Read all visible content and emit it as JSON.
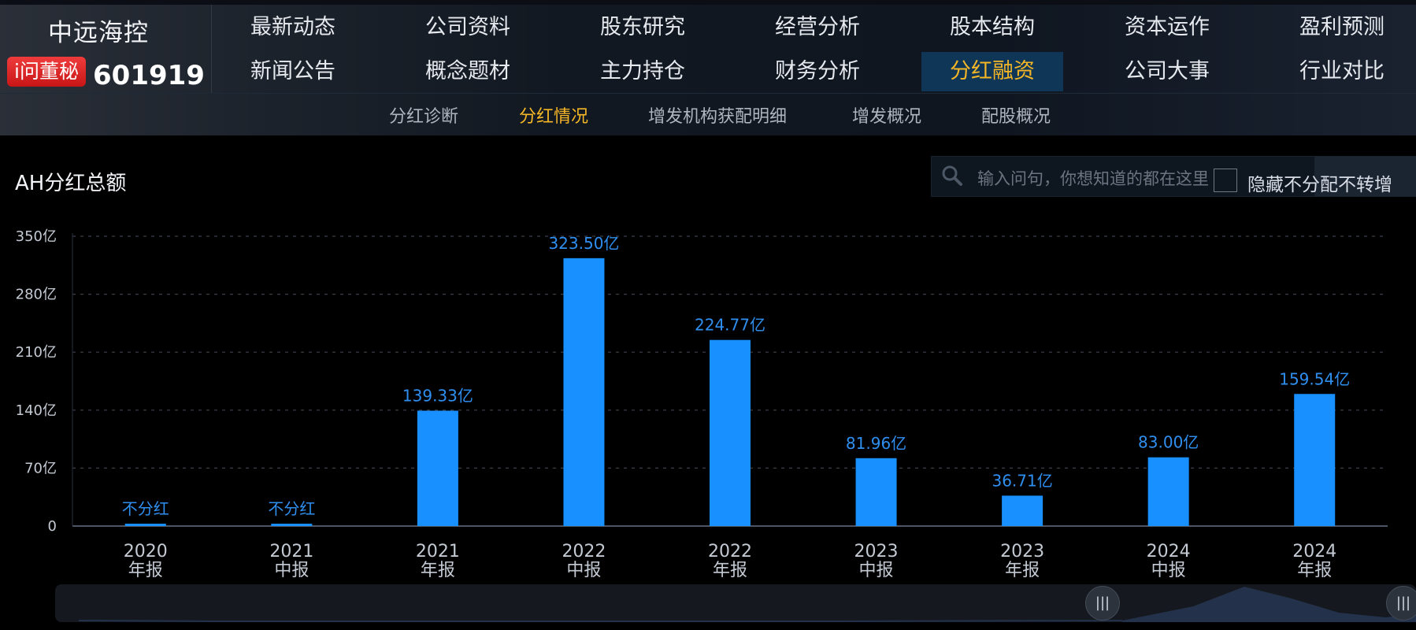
{
  "company": {
    "name": "中远海控",
    "badge": "i问董秘",
    "code": "601919"
  },
  "nav": {
    "row1": [
      "最新动态",
      "公司资料",
      "股东研究",
      "经营分析",
      "股本结构",
      "资本运作",
      "盈利预测"
    ],
    "row2": [
      "新闻公告",
      "概念题材",
      "主力持仓",
      "财务分析",
      "分红融资",
      "公司大事",
      "行业对比"
    ],
    "active": "分红融资"
  },
  "subnav": {
    "items": [
      "分红诊断",
      "分红情况",
      "增发机构获配明细",
      "增发概况",
      "配股概况"
    ],
    "active": "分红情况"
  },
  "search": {
    "placeholder": "输入问句，你想知道的都在这里"
  },
  "hide_toggle_label": "隐藏不分配不转增",
  "icons": [
    "search-icon",
    "scroll-handle-icon"
  ],
  "colors": {
    "bar": "#1890ff",
    "label": "#2f8ff0",
    "accent": "#f4b627",
    "badge": "#e02323"
  },
  "chart_data": {
    "type": "bar",
    "title": "AH分红总额",
    "categories": [
      [
        "2020",
        "年报"
      ],
      [
        "2021",
        "中报"
      ],
      [
        "2021",
        "年报"
      ],
      [
        "2022",
        "中报"
      ],
      [
        "2022",
        "年报"
      ],
      [
        "2023",
        "中报"
      ],
      [
        "2023",
        "年报"
      ],
      [
        "2024",
        "中报"
      ],
      [
        "2024",
        "年报"
      ]
    ],
    "values": [
      0,
      0,
      139.33,
      323.5,
      224.77,
      81.96,
      36.71,
      83.0,
      159.54
    ],
    "data_labels": [
      "不分红",
      "不分红",
      "139.33亿",
      "323.50亿",
      "224.77亿",
      "81.96亿",
      "36.71亿",
      "83.00亿",
      "159.54亿"
    ],
    "y_ticks": [
      0,
      70,
      140,
      210,
      280,
      350
    ],
    "y_tick_labels": [
      "0",
      "70亿",
      "140亿",
      "210亿",
      "280亿",
      "350亿"
    ],
    "ylim": [
      0,
      350
    ],
    "grid": true,
    "legend": "none"
  }
}
